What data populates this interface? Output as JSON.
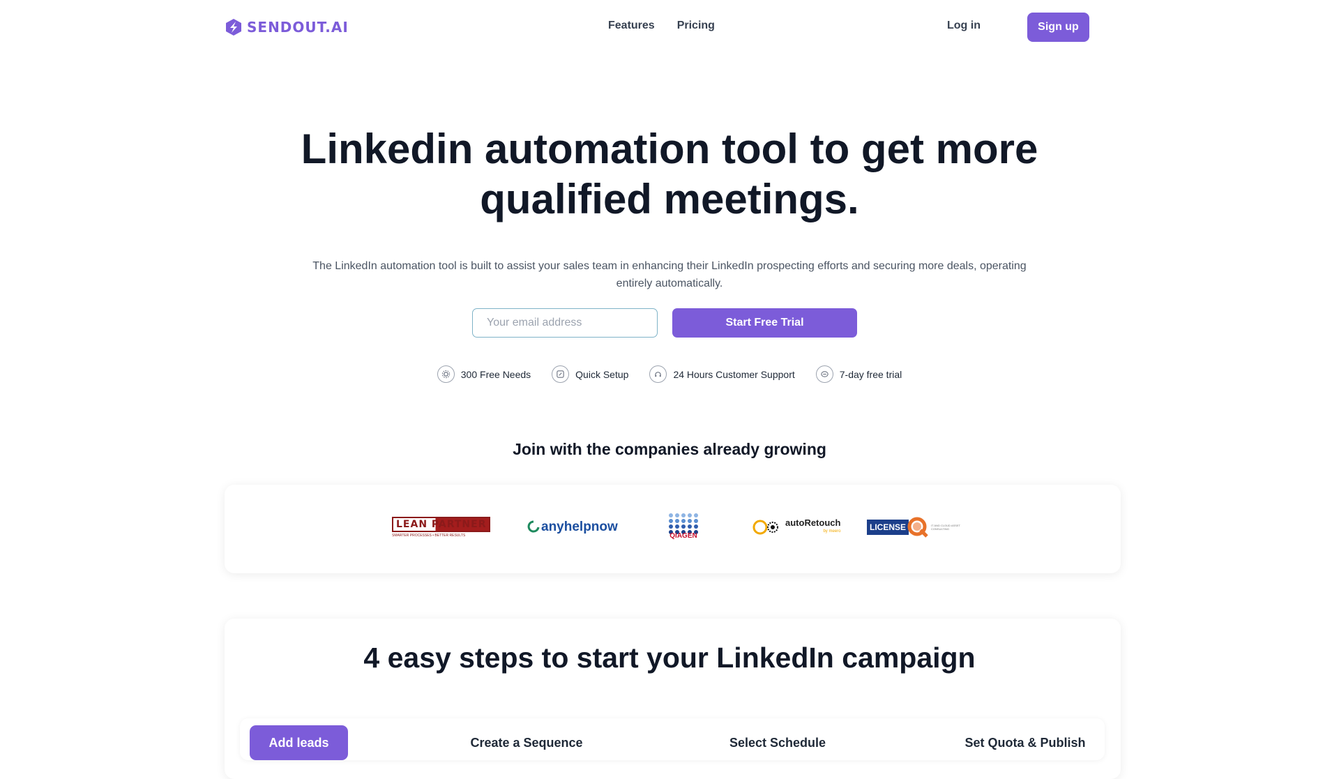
{
  "header": {
    "logo_text": "SENDOUT.AI",
    "nav": [
      {
        "label": "Features"
      },
      {
        "label": "Pricing"
      }
    ],
    "login_label": "Log in",
    "signup_label": "Sign up"
  },
  "hero": {
    "title_line1": "Linkedin automation tool to get more",
    "title_line2": "qualified meetings.",
    "subtitle": "The LinkedIn automation tool is built to assist your sales team in enhancing their LinkedIn prospecting efforts and securing more deals, operating entirely automatically.",
    "email_placeholder": "Your email address",
    "cta_label": "Start Free Trial",
    "features": [
      {
        "label": "300 Free Needs",
        "icon": "gear-icon"
      },
      {
        "label": "Quick Setup",
        "icon": "edit-icon"
      },
      {
        "label": "24 Hours Customer Support",
        "icon": "support-icon"
      },
      {
        "label": "7-day free trial",
        "icon": "chat-icon"
      }
    ]
  },
  "companies": {
    "title": "Join with the companies already growing",
    "logos": [
      {
        "name": "LEAN PARTNER",
        "tagline": "SMARTER PROCESSES • BETTER RESULTS"
      },
      {
        "name": "anyhelpnow"
      },
      {
        "name": "QIAGEN"
      },
      {
        "name": "autoRetouch",
        "tagline": "by meero"
      },
      {
        "name": "LICENSE",
        "tagline": "IT AND CLOUD ASSET CONSULTING"
      }
    ]
  },
  "steps": {
    "title": "4 easy steps to start your LinkedIn campaign",
    "tabs": [
      {
        "label": "Add leads"
      },
      {
        "label": "Create a Sequence"
      },
      {
        "label": "Select Schedule"
      },
      {
        "label": "Set Quota & Publish"
      }
    ]
  },
  "colors": {
    "brand": "#7c5cd9",
    "text_dark": "#111827",
    "text_muted": "#4b5563"
  }
}
